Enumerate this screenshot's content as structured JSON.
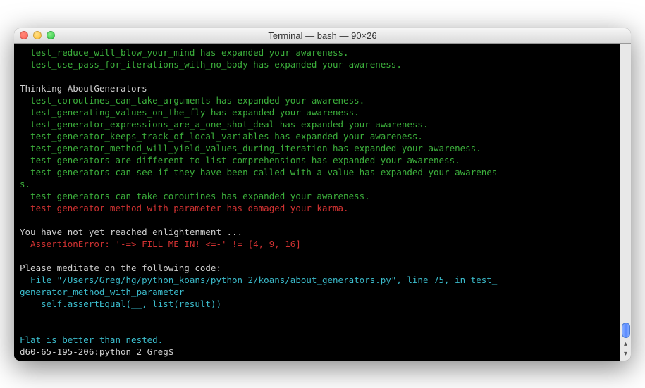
{
  "window": {
    "title": "Terminal — bash — 90×26"
  },
  "output": {
    "line1": "test_reduce_will_blow_your_mind has expanded your awareness.",
    "line2": "test_use_pass_for_iterations_with_no_body has expanded your awareness.",
    "blank1": " ",
    "thinking": "Thinking AboutGenerators",
    "t1": "test_coroutines_can_take_arguments has expanded your awareness.",
    "t2": "test_generating_values_on_the_fly has expanded your awareness.",
    "t3": "test_generator_expressions_are_a_one_shot_deal has expanded your awareness.",
    "t4": "test_generator_keeps_track_of_local_variables has expanded your awareness.",
    "t5": "test_generator_method_will_yield_values_during_iteration has expanded your awareness.",
    "t6": "test_generators_are_different_to_list_comprehensions has expanded your awareness.",
    "t7a": "test_generators_can_see_if_they_have_been_called_with_a_value has expanded your awarenes",
    "t7b": "s.",
    "t8": "test_generators_can_take_coroutines has expanded your awareness.",
    "t9": "test_generator_method_with_parameter has damaged your karma.",
    "blank2": " ",
    "notyet": "You have not yet reached enlightenment ...",
    "assert": "AssertionError: '-=> FILL ME IN! <=-' != [4, 9, 16]",
    "blank3": " ",
    "meditate": "Please meditate on the following code:",
    "file1": "File \"/Users/Greg/hg/python_koans/python 2/koans/about_generators.py\", line 75, in test_",
    "file2": "generator_method_with_parameter",
    "file3": "self.assertEqual(__, list(result))",
    "blank4": " ",
    "blank5": " ",
    "flat": "Flat is better than nested.",
    "prompt": "d60-65-195-206:python 2 Greg$ "
  }
}
